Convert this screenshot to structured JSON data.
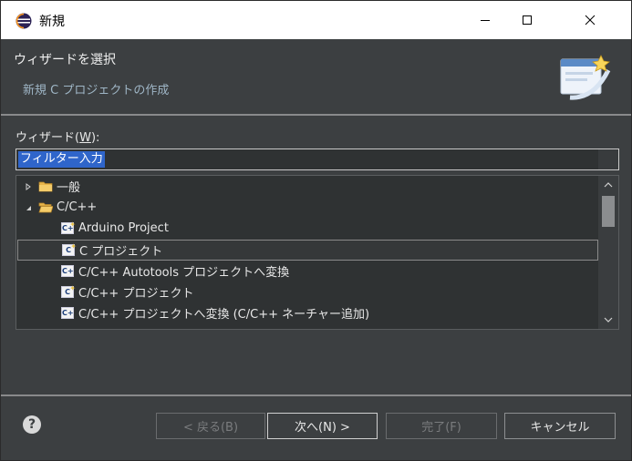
{
  "window": {
    "title": "新規"
  },
  "header": {
    "title": "ウィザードを選択",
    "description": "新規 C プロジェクトの作成"
  },
  "wizard_label": {
    "prefix": "ウィザード(",
    "mnemonic": "W",
    "suffix": "):"
  },
  "filter": {
    "value": "フィルター入力"
  },
  "tree": {
    "items": [
      {
        "label": "一般",
        "icon": "folder-icon",
        "expanded": false
      },
      {
        "label": "C/C++",
        "icon": "folder-open-icon",
        "expanded": true
      },
      {
        "label": "Arduino Project",
        "icon": "cpp-project-icon"
      },
      {
        "label": "C プロジェクト",
        "icon": "c-project-icon",
        "selected": true
      },
      {
        "label": "C/C++ Autotools プロジェクトへ変換",
        "icon": "cpp-convert-icon"
      },
      {
        "label": "C/C++ プロジェクト",
        "icon": "c-project-icon"
      },
      {
        "label": "C/C++ プロジェクトへ変換 (C/C++ ネーチャー追加)",
        "icon": "cpp-convert-icon"
      }
    ]
  },
  "buttons": {
    "back": "< 戻る(B)",
    "next": "次へ(N) >",
    "finish": "完了(F)",
    "cancel": "キャンセル"
  },
  "colors": {
    "background": "#3c3f41",
    "selection": "#2f65ca",
    "description": "#9fb6c6"
  }
}
